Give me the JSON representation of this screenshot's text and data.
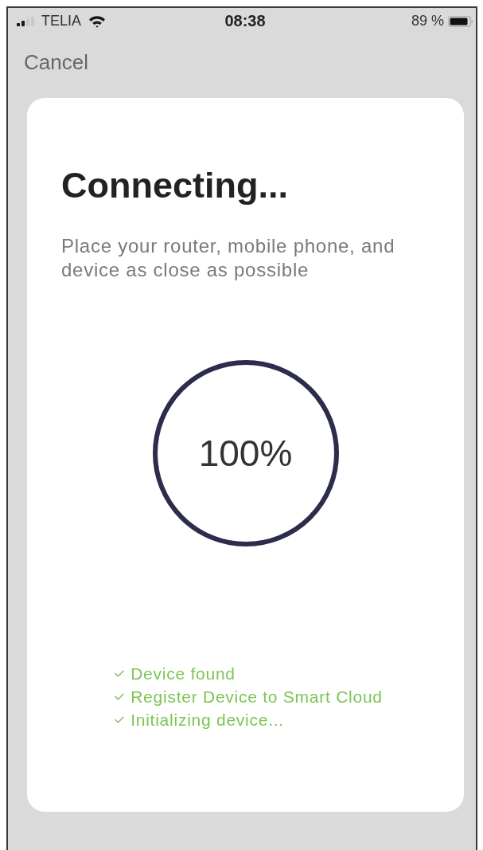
{
  "status_bar": {
    "carrier": "TELIA",
    "time": "08:38",
    "battery": "89 %"
  },
  "nav": {
    "cancel": "Cancel"
  },
  "card": {
    "title": "Connecting...",
    "description": "Place your router, mobile phone, and device as close as possible",
    "progress": {
      "level": 1,
      "reading": "100%"
    },
    "steps": [
      {
        "label": "Device found"
      },
      {
        "label": "Register Device to Smart Cloud"
      },
      {
        "label": "Initializing device..."
      }
    ]
  }
}
